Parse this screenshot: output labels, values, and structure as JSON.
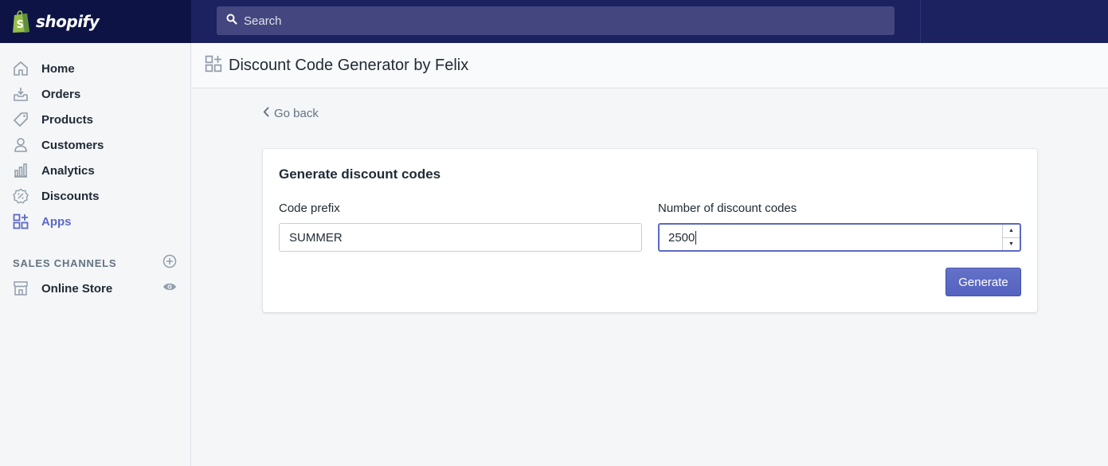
{
  "brand": {
    "name": "shopify"
  },
  "search": {
    "placeholder": "Search"
  },
  "sidebar": {
    "items": [
      {
        "label": "Home",
        "icon": "home-icon"
      },
      {
        "label": "Orders",
        "icon": "orders-icon"
      },
      {
        "label": "Products",
        "icon": "tag-icon"
      },
      {
        "label": "Customers",
        "icon": "person-icon"
      },
      {
        "label": "Analytics",
        "icon": "bar-chart-icon"
      },
      {
        "label": "Discounts",
        "icon": "discount-icon"
      },
      {
        "label": "Apps",
        "icon": "apps-icon",
        "active": true
      }
    ],
    "sales_channels_header": "SALES CHANNELS",
    "online_store": "Online Store"
  },
  "page": {
    "title": "Discount Code Generator by Felix"
  },
  "go_back": "Go back",
  "card": {
    "title": "Generate discount codes",
    "prefix_label": "Code prefix",
    "prefix_value": "SUMMER",
    "count_label": "Number of discount codes",
    "count_value": "2500",
    "button_label": "Generate"
  },
  "colors": {
    "topbar": "#1c2260",
    "accent": "#5c6ac4",
    "logo_green": "#95bf47"
  }
}
